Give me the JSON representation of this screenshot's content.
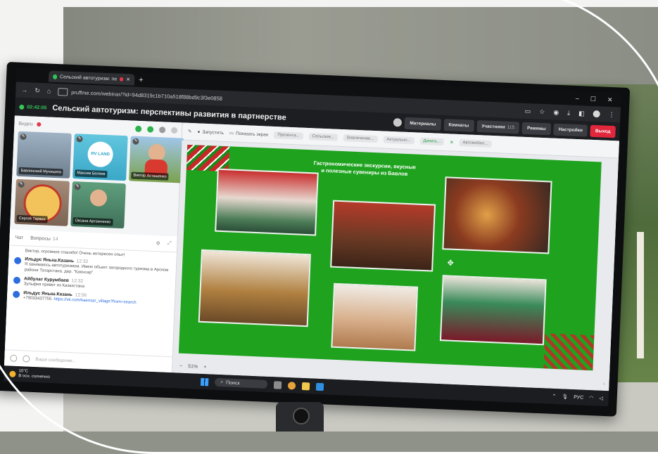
{
  "browser": {
    "tab_title": "Сельский автотуризм: пе",
    "url": "pruffme.com/webinar/?id=94d8319c1b710a518f88bd9c3f3e0858"
  },
  "webinar": {
    "timer": "02:42:05",
    "title": "Сельский автотуризм: перспективы развития в партнерстве",
    "buttons": {
      "materials": "Материалы",
      "rooms": "Комнаты",
      "participants": "Участники",
      "participants_count": "115",
      "modes": "Режимы",
      "settings": "Настройки",
      "exit": "Выход"
    }
  },
  "video": {
    "label": "Видео",
    "participants": [
      {
        "name": "Бавлинский Муниципа"
      },
      {
        "name": "Максим Беляев",
        "logo": "RV LAND"
      },
      {
        "name": "Виктор Асташенко"
      },
      {
        "name": "Сергей Тарвин"
      },
      {
        "name": "Оксана Артемченко"
      }
    ]
  },
  "chat": {
    "tab_chat": "Чат",
    "tab_questions": "Вопросы",
    "questions_count": "14",
    "first_line": "Виктор, огромное спасибо! Очень интересен опыт!",
    "messages": [
      {
        "author": "Ильдус Яныш.Казань",
        "time": "12:32",
        "text": "Я занимаюсь автотуризмом. Имею объект загородного туризма в Арском районе Татарстана. дер. \"Каенсар\"",
        "link": ""
      },
      {
        "author": "Айбулат Курумбаев",
        "time": "12:32",
        "text": "Зульфия привет из Казахстана",
        "link": ""
      },
      {
        "author": "Ильдус Яныш.Казань",
        "time": "12:56",
        "text": "+79033437755.",
        "link": "https://vk.com/kaensar_village?from=search"
      }
    ],
    "input_placeholder": "Ваше сообщение..."
  },
  "toolbar": {
    "start": "Запустить",
    "show_screen": "Показать экран",
    "chips": [
      "Презента...",
      "Сельские...",
      "Вовлечение...",
      "Актуально...",
      "Дачить..."
    ],
    "active_chip_index": 4,
    "extra": "Автомобил..."
  },
  "slide": {
    "caption": "Гастрономические экскурсии, вкусные и полезные сувениры из Бавлов",
    "zoom": "51%"
  },
  "taskbar": {
    "temp": "10°C",
    "weather": "В осн. солнечно",
    "search": "Поиск",
    "lang": "РУС"
  },
  "colors": {
    "exit": "#e0273c",
    "slide_bg": "#1fa31f",
    "timer": "#34c759"
  }
}
